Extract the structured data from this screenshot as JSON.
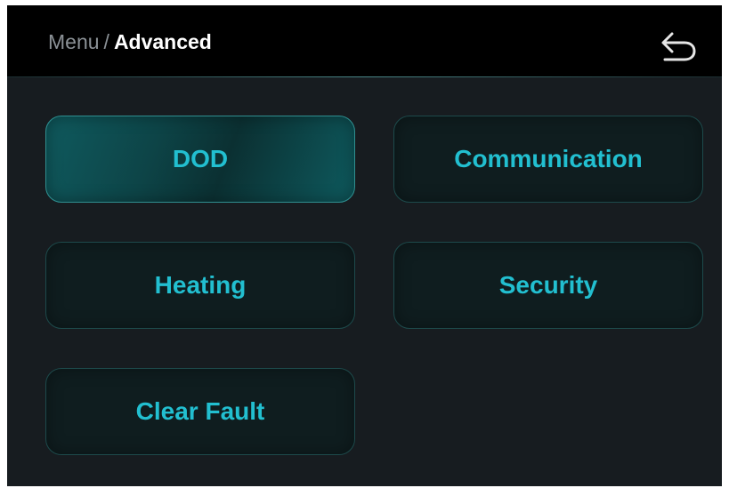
{
  "header": {
    "breadcrumb_root": "Menu",
    "breadcrumb_separator": "/",
    "breadcrumb_current": "Advanced",
    "back_icon": "back-arrow-icon"
  },
  "menu": {
    "items": [
      {
        "label": "DOD",
        "selected": true
      },
      {
        "label": "Communication",
        "selected": false
      },
      {
        "label": "Heating",
        "selected": false
      },
      {
        "label": "Security",
        "selected": false
      },
      {
        "label": "Clear Fault",
        "selected": false
      }
    ]
  },
  "colors": {
    "screen_background": "#171c20",
    "header_background": "#000000",
    "accent_text": "#22bfd0",
    "selected_tile": "#0f5a5e",
    "tile_border": "#1d4a4b"
  }
}
